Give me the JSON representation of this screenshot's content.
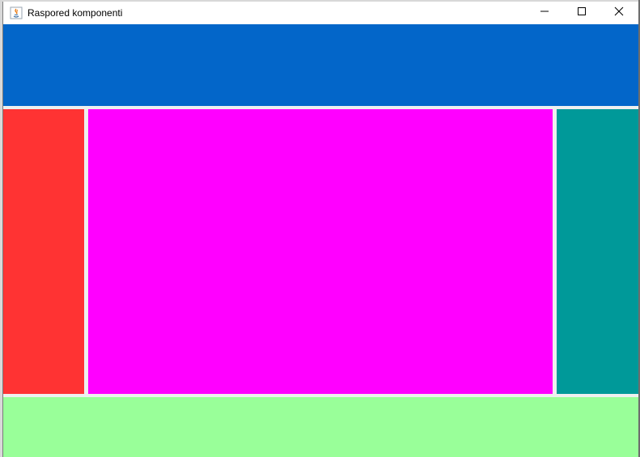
{
  "window": {
    "title": "Raspored komponenti",
    "controls": {
      "minimize_icon": "minimize-icon",
      "maximize_icon": "maximize-icon",
      "close_icon": "close-icon"
    },
    "app_icon": "java-app-icon"
  },
  "layout_regions": {
    "north": {
      "color": "#0366c9"
    },
    "west": {
      "color": "#ff3333"
    },
    "center": {
      "color": "#ff00ff"
    },
    "east": {
      "color": "#009999"
    },
    "south": {
      "color": "#99ff99"
    }
  },
  "colors": {
    "titlebar": "#ffffff",
    "gap": "#eef0ef"
  }
}
